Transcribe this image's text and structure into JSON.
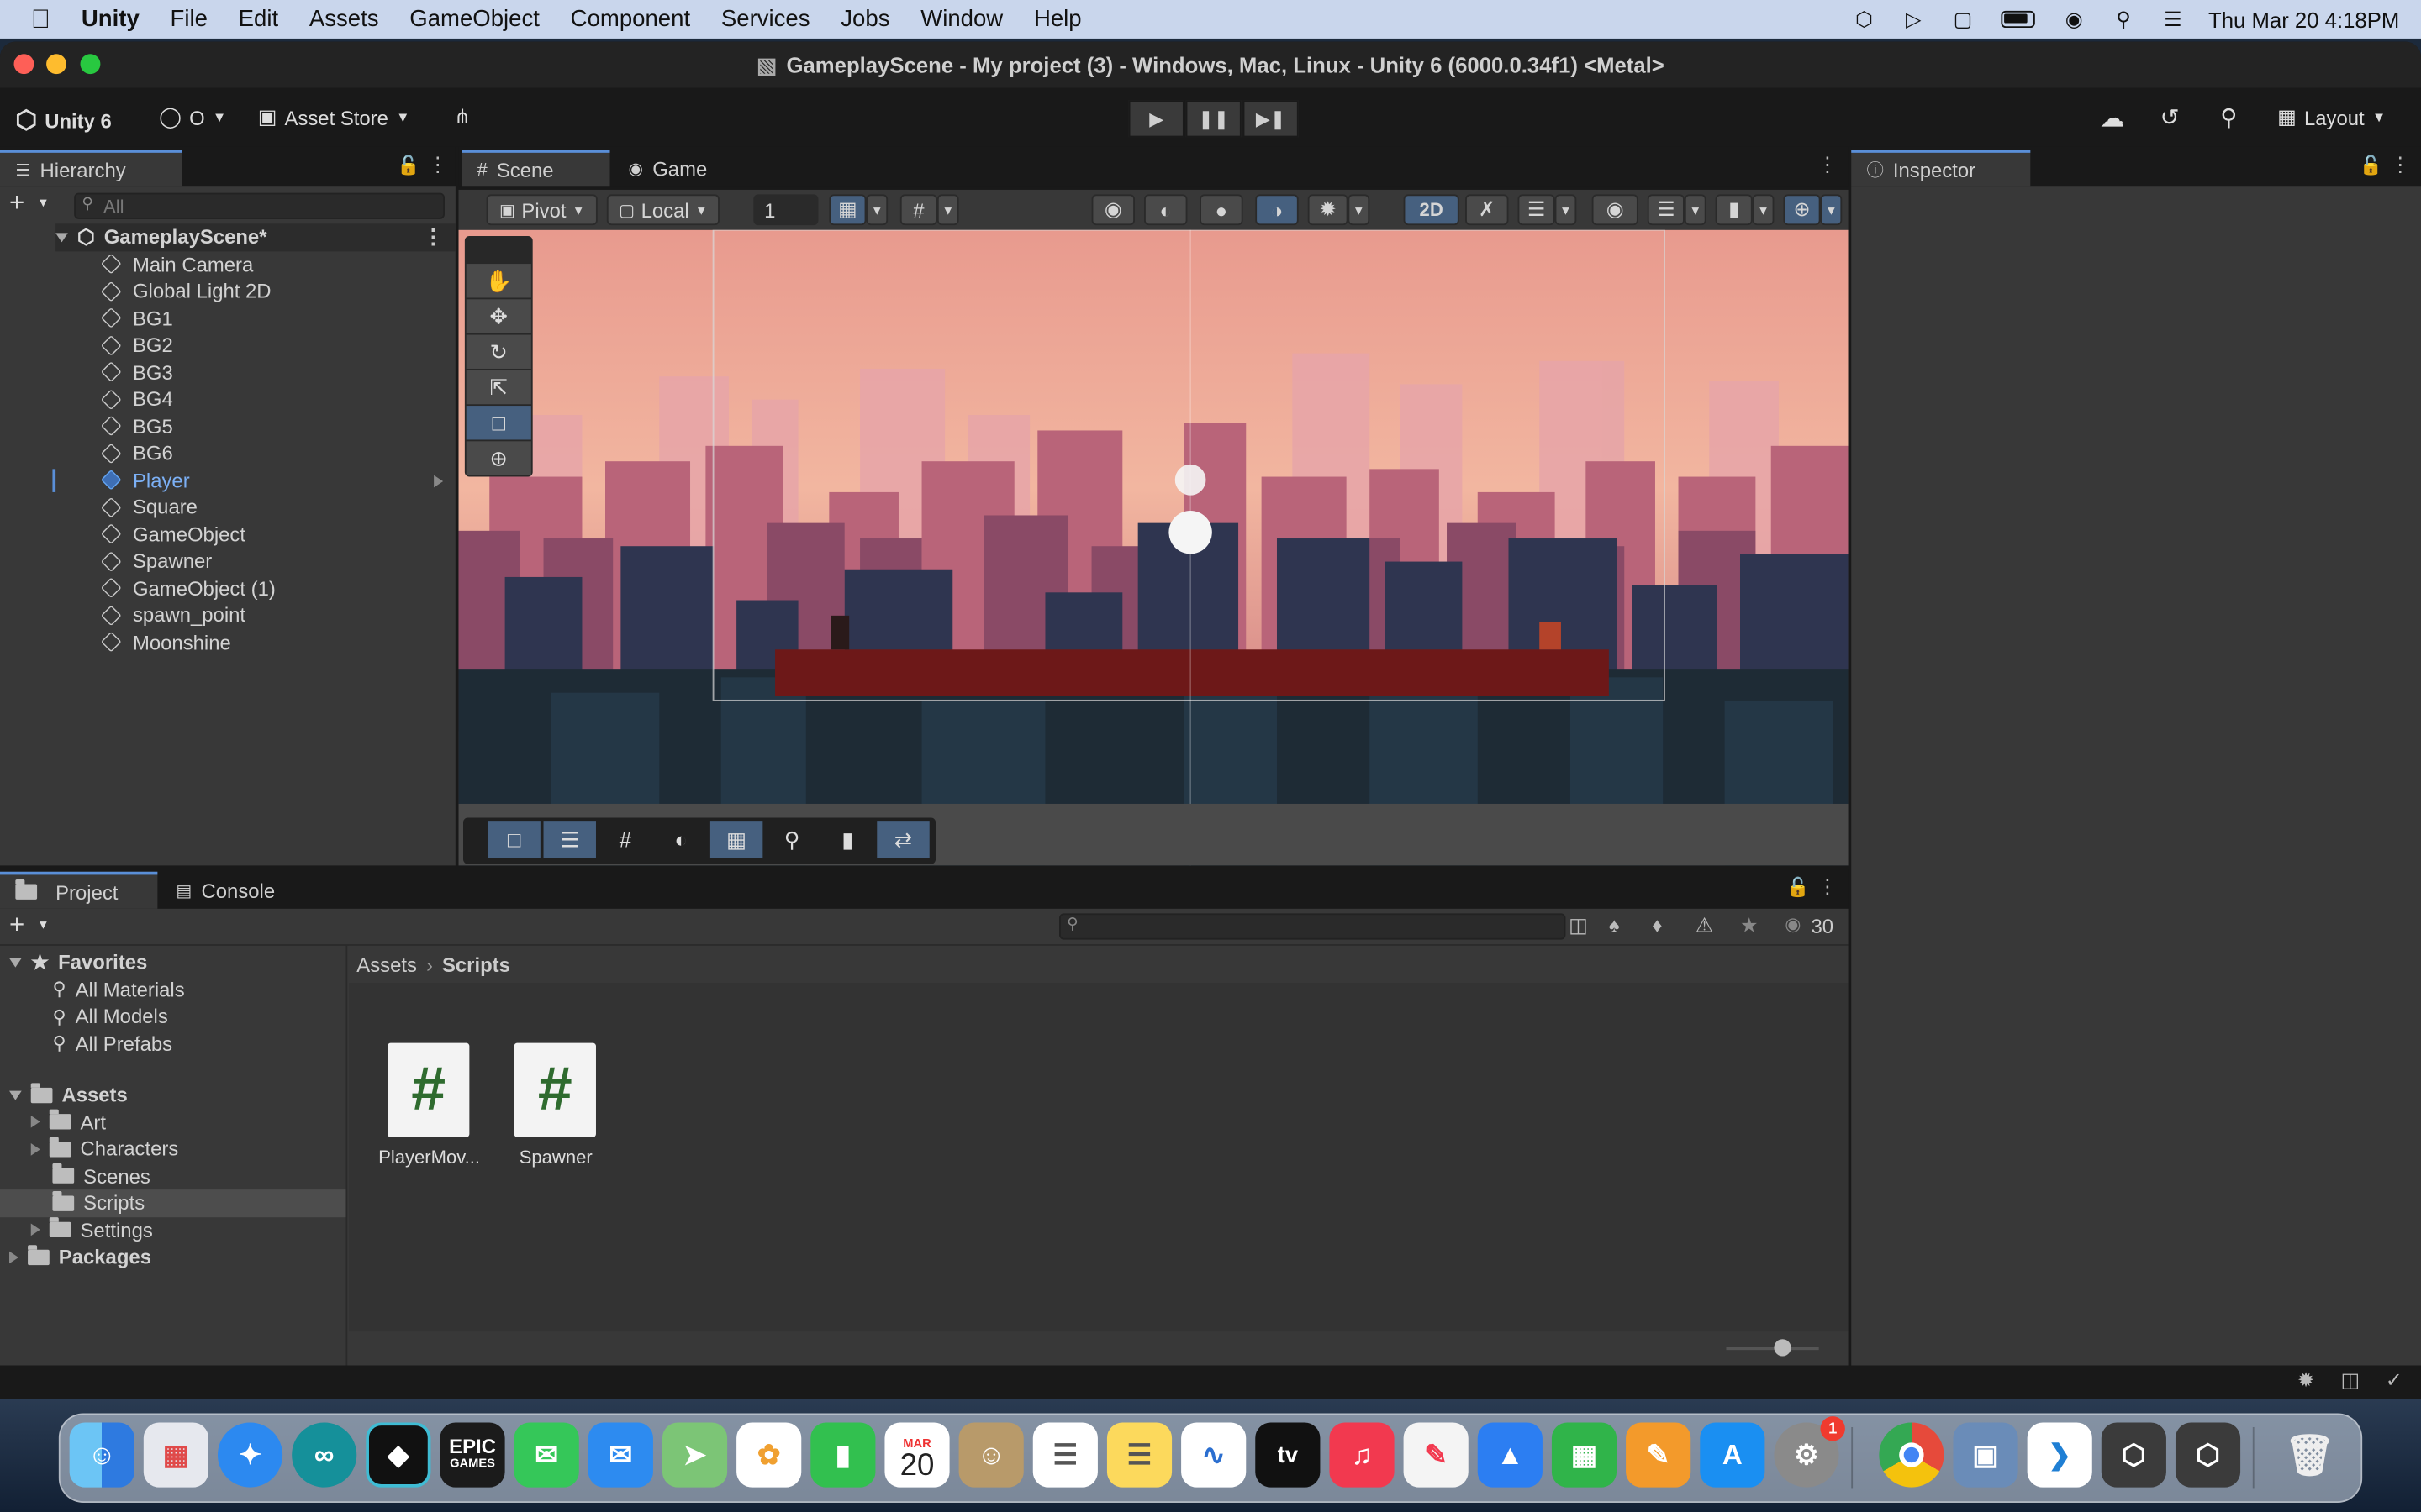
{
  "menubar": {
    "app": "Unity",
    "items": [
      "File",
      "Edit",
      "Assets",
      "GameObject",
      "Component",
      "Services",
      "Jobs",
      "Window",
      "Help"
    ],
    "clock": "Thu Mar 20  4:18PM"
  },
  "window": {
    "title": "GameplayScene - My project (3) - Windows, Mac, Linux - Unity 6 (6000.0.34f1) <Metal>"
  },
  "toolbar": {
    "unity_version": "Unity 6",
    "account": "O",
    "asset_store": "Asset Store",
    "layout": "Layout"
  },
  "hierarchy": {
    "tab": "Hierarchy",
    "search_placeholder": "All",
    "scene": "GameplayScene*",
    "items": [
      "Main Camera",
      "Global Light 2D",
      "BG1",
      "BG2",
      "BG3",
      "BG4",
      "BG5",
      "BG6",
      "Player",
      "Square",
      "GameObject",
      "Spawner",
      "GameObject (1)",
      "spawn_point",
      "Moonshine"
    ],
    "selected": "Player"
  },
  "scene_view": {
    "tabs": [
      "Scene",
      "Game"
    ],
    "pivot": "Pivot",
    "local": "Local",
    "snap_value": "1",
    "mode_2d": "2D"
  },
  "inspector": {
    "tab": "Inspector"
  },
  "project": {
    "tabs": [
      "Project",
      "Console"
    ],
    "hidden_count": "30",
    "breadcrumb": [
      "Assets",
      "Scripts"
    ],
    "favorites_label": "Favorites",
    "favorites": [
      "All Materials",
      "All Models",
      "All Prefabs"
    ],
    "assets_label": "Assets",
    "assets": [
      "Art",
      "Characters",
      "Scenes",
      "Scripts",
      "Settings"
    ],
    "packages_label": "Packages",
    "files": [
      {
        "name": "PlayerMov...",
        "glyph": "#"
      },
      {
        "name": "Spawner",
        "glyph": "#"
      }
    ]
  },
  "colors": {
    "accent": "#5a8fd8",
    "selection": "#2c5d87",
    "panel": "#383838"
  },
  "dock": {
    "calendar_month": "MAR",
    "calendar_day": "20",
    "settings_badge": "1",
    "epic_label": "EPIC",
    "epic_sub": "GAMES",
    "tv_label": "tv"
  }
}
